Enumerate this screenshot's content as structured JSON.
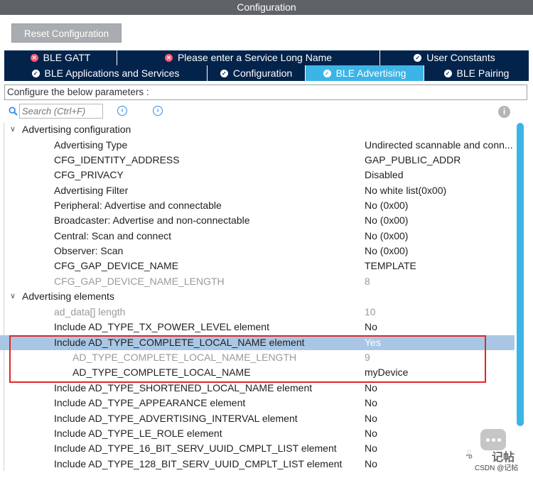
{
  "window": {
    "title": "Configuration"
  },
  "toolbar": {
    "reset_label": "Reset Configuration"
  },
  "tabs_row1": [
    {
      "label": "BLE GATT",
      "status": "error"
    },
    {
      "label": "Please enter a Service Long Name",
      "status": "error"
    },
    {
      "label": "User Constants",
      "status": "ok"
    }
  ],
  "tabs_row2": [
    {
      "label": "BLE Applications and Services",
      "status": "ok"
    },
    {
      "label": "Configuration",
      "status": "ok"
    },
    {
      "label": "BLE Advertising",
      "status": "ok",
      "active": true
    },
    {
      "label": "BLE Pairing",
      "status": "ok"
    }
  ],
  "params_label": "Configure the below parameters :",
  "search": {
    "placeholder": "Search (Ctrl+F)"
  },
  "groups": [
    {
      "label": "Advertising configuration"
    },
    {
      "label": "Advertising elements"
    }
  ],
  "params": [
    {
      "name": "Advertising Type",
      "value": "Undirected scannable and conn..."
    },
    {
      "name": "CFG_IDENTITY_ADDRESS",
      "value": "GAP_PUBLIC_ADDR"
    },
    {
      "name": "CFG_PRIVACY",
      "value": "Disabled"
    },
    {
      "name": "Advertising Filter",
      "value": "No white list(0x00)"
    },
    {
      "name": "Peripheral: Advertise and connectable",
      "value": "No (0x00)"
    },
    {
      "name": "Broadcaster: Advertise and non-connectable",
      "value": "No (0x00)"
    },
    {
      "name": "Central: Scan and connect",
      "value": "No (0x00)"
    },
    {
      "name": "Observer: Scan",
      "value": "No (0x00)"
    },
    {
      "name": "CFG_GAP_DEVICE_NAME",
      "value": "TEMPLATE"
    },
    {
      "name": "CFG_GAP_DEVICE_NAME_LENGTH",
      "value": "8"
    },
    {
      "name": "ad_data[] length",
      "value": "10"
    },
    {
      "name": "Include AD_TYPE_TX_POWER_LEVEL element",
      "value": "No"
    },
    {
      "name": "Include AD_TYPE_COMPLETE_LOCAL_NAME element",
      "value": "Yes"
    },
    {
      "name": "AD_TYPE_COMPLETE_LOCAL_NAME_LENGTH",
      "value": "9"
    },
    {
      "name": "AD_TYPE_COMPLETE_LOCAL_NAME",
      "value": "myDevice"
    },
    {
      "name": "Include AD_TYPE_SHORTENED_LOCAL_NAME  element",
      "value": "No"
    },
    {
      "name": "Include AD_TYPE_APPEARANCE element",
      "value": "No"
    },
    {
      "name": "Include AD_TYPE_ADVERTISING_INTERVAL element",
      "value": "No"
    },
    {
      "name": "Include AD_TYPE_LE_ROLE element",
      "value": "No"
    },
    {
      "name": "Include AD_TYPE_16_BIT_SERV_UUID_CMPLT_LIST element",
      "value": "No"
    },
    {
      "name": "Include AD_TYPE_128_BIT_SERV_UUID_CMPLT_LIST element",
      "value": "No"
    }
  ],
  "watermark": {
    "logo_text": "记帖",
    "sub_text": "CSDN @记帖"
  },
  "colors": {
    "tab_bg": "#03234b",
    "tab_active": "#3cb4e6",
    "selection": "#a9c7e4",
    "highlight": "#e0262a"
  }
}
